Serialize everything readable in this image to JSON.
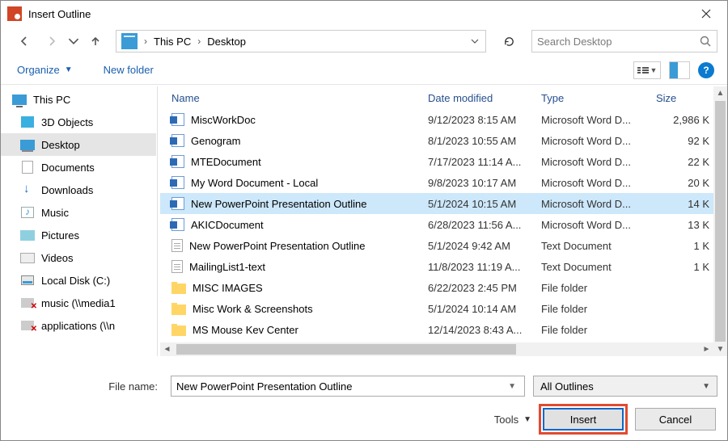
{
  "window": {
    "title": "Insert Outline"
  },
  "nav": {
    "breadcrumb": [
      "This PC",
      "Desktop"
    ],
    "search_placeholder": "Search Desktop"
  },
  "toolbar": {
    "organize": "Organize",
    "new_folder": "New folder"
  },
  "tree": {
    "root": "This PC",
    "items": [
      {
        "label": "3D Objects",
        "icon": "cube"
      },
      {
        "label": "Desktop",
        "icon": "desktop",
        "selected": true
      },
      {
        "label": "Documents",
        "icon": "doc"
      },
      {
        "label": "Downloads",
        "icon": "download"
      },
      {
        "label": "Music",
        "icon": "music"
      },
      {
        "label": "Pictures",
        "icon": "pic"
      },
      {
        "label": "Videos",
        "icon": "vid"
      },
      {
        "label": "Local Disk (C:)",
        "icon": "disk"
      },
      {
        "label": "music (\\\\media1",
        "icon": "netx"
      },
      {
        "label": "applications (\\\\n",
        "icon": "netx"
      }
    ]
  },
  "columns": {
    "name": "Name",
    "date": "Date modified",
    "type": "Type",
    "size": "Size"
  },
  "files": [
    {
      "name": "MiscWorkDoc",
      "date": "9/12/2023 8:15 AM",
      "type": "Microsoft Word D...",
      "size": "2,986 K",
      "icon": "word"
    },
    {
      "name": "Genogram",
      "date": "8/1/2023 10:55 AM",
      "type": "Microsoft Word D...",
      "size": "92 K",
      "icon": "word"
    },
    {
      "name": "MTEDocument",
      "date": "7/17/2023 11:14 A...",
      "type": "Microsoft Word D...",
      "size": "22 K",
      "icon": "word"
    },
    {
      "name": "My Word Document - Local",
      "date": "9/8/2023 10:17 AM",
      "type": "Microsoft Word D...",
      "size": "20 K",
      "icon": "word"
    },
    {
      "name": "New PowerPoint Presentation Outline",
      "date": "5/1/2024 10:15 AM",
      "type": "Microsoft Word D...",
      "size": "14 K",
      "icon": "word",
      "selected": true
    },
    {
      "name": "AKICDocument",
      "date": "6/28/2023 11:56 A...",
      "type": "Microsoft Word D...",
      "size": "13 K",
      "icon": "word"
    },
    {
      "name": "New PowerPoint Presentation Outline",
      "date": "5/1/2024 9:42 AM",
      "type": "Text Document",
      "size": "1 K",
      "icon": "txt"
    },
    {
      "name": "MailingList1-text",
      "date": "11/8/2023 11:19 A...",
      "type": "Text Document",
      "size": "1 K",
      "icon": "txt"
    },
    {
      "name": "MISC IMAGES",
      "date": "6/22/2023 2:45 PM",
      "type": "File folder",
      "size": "",
      "icon": "folder"
    },
    {
      "name": "Misc Work & Screenshots",
      "date": "5/1/2024 10:14 AM",
      "type": "File folder",
      "size": "",
      "icon": "folder"
    },
    {
      "name": "MS Mouse Kev Center",
      "date": "12/14/2023 8:43 A...",
      "type": "File folder",
      "size": "",
      "icon": "folder"
    }
  ],
  "footer": {
    "filename_label": "File name:",
    "filename_value": "New PowerPoint Presentation Outline",
    "filter": "All Outlines",
    "tools": "Tools",
    "insert": "Insert",
    "cancel": "Cancel"
  }
}
